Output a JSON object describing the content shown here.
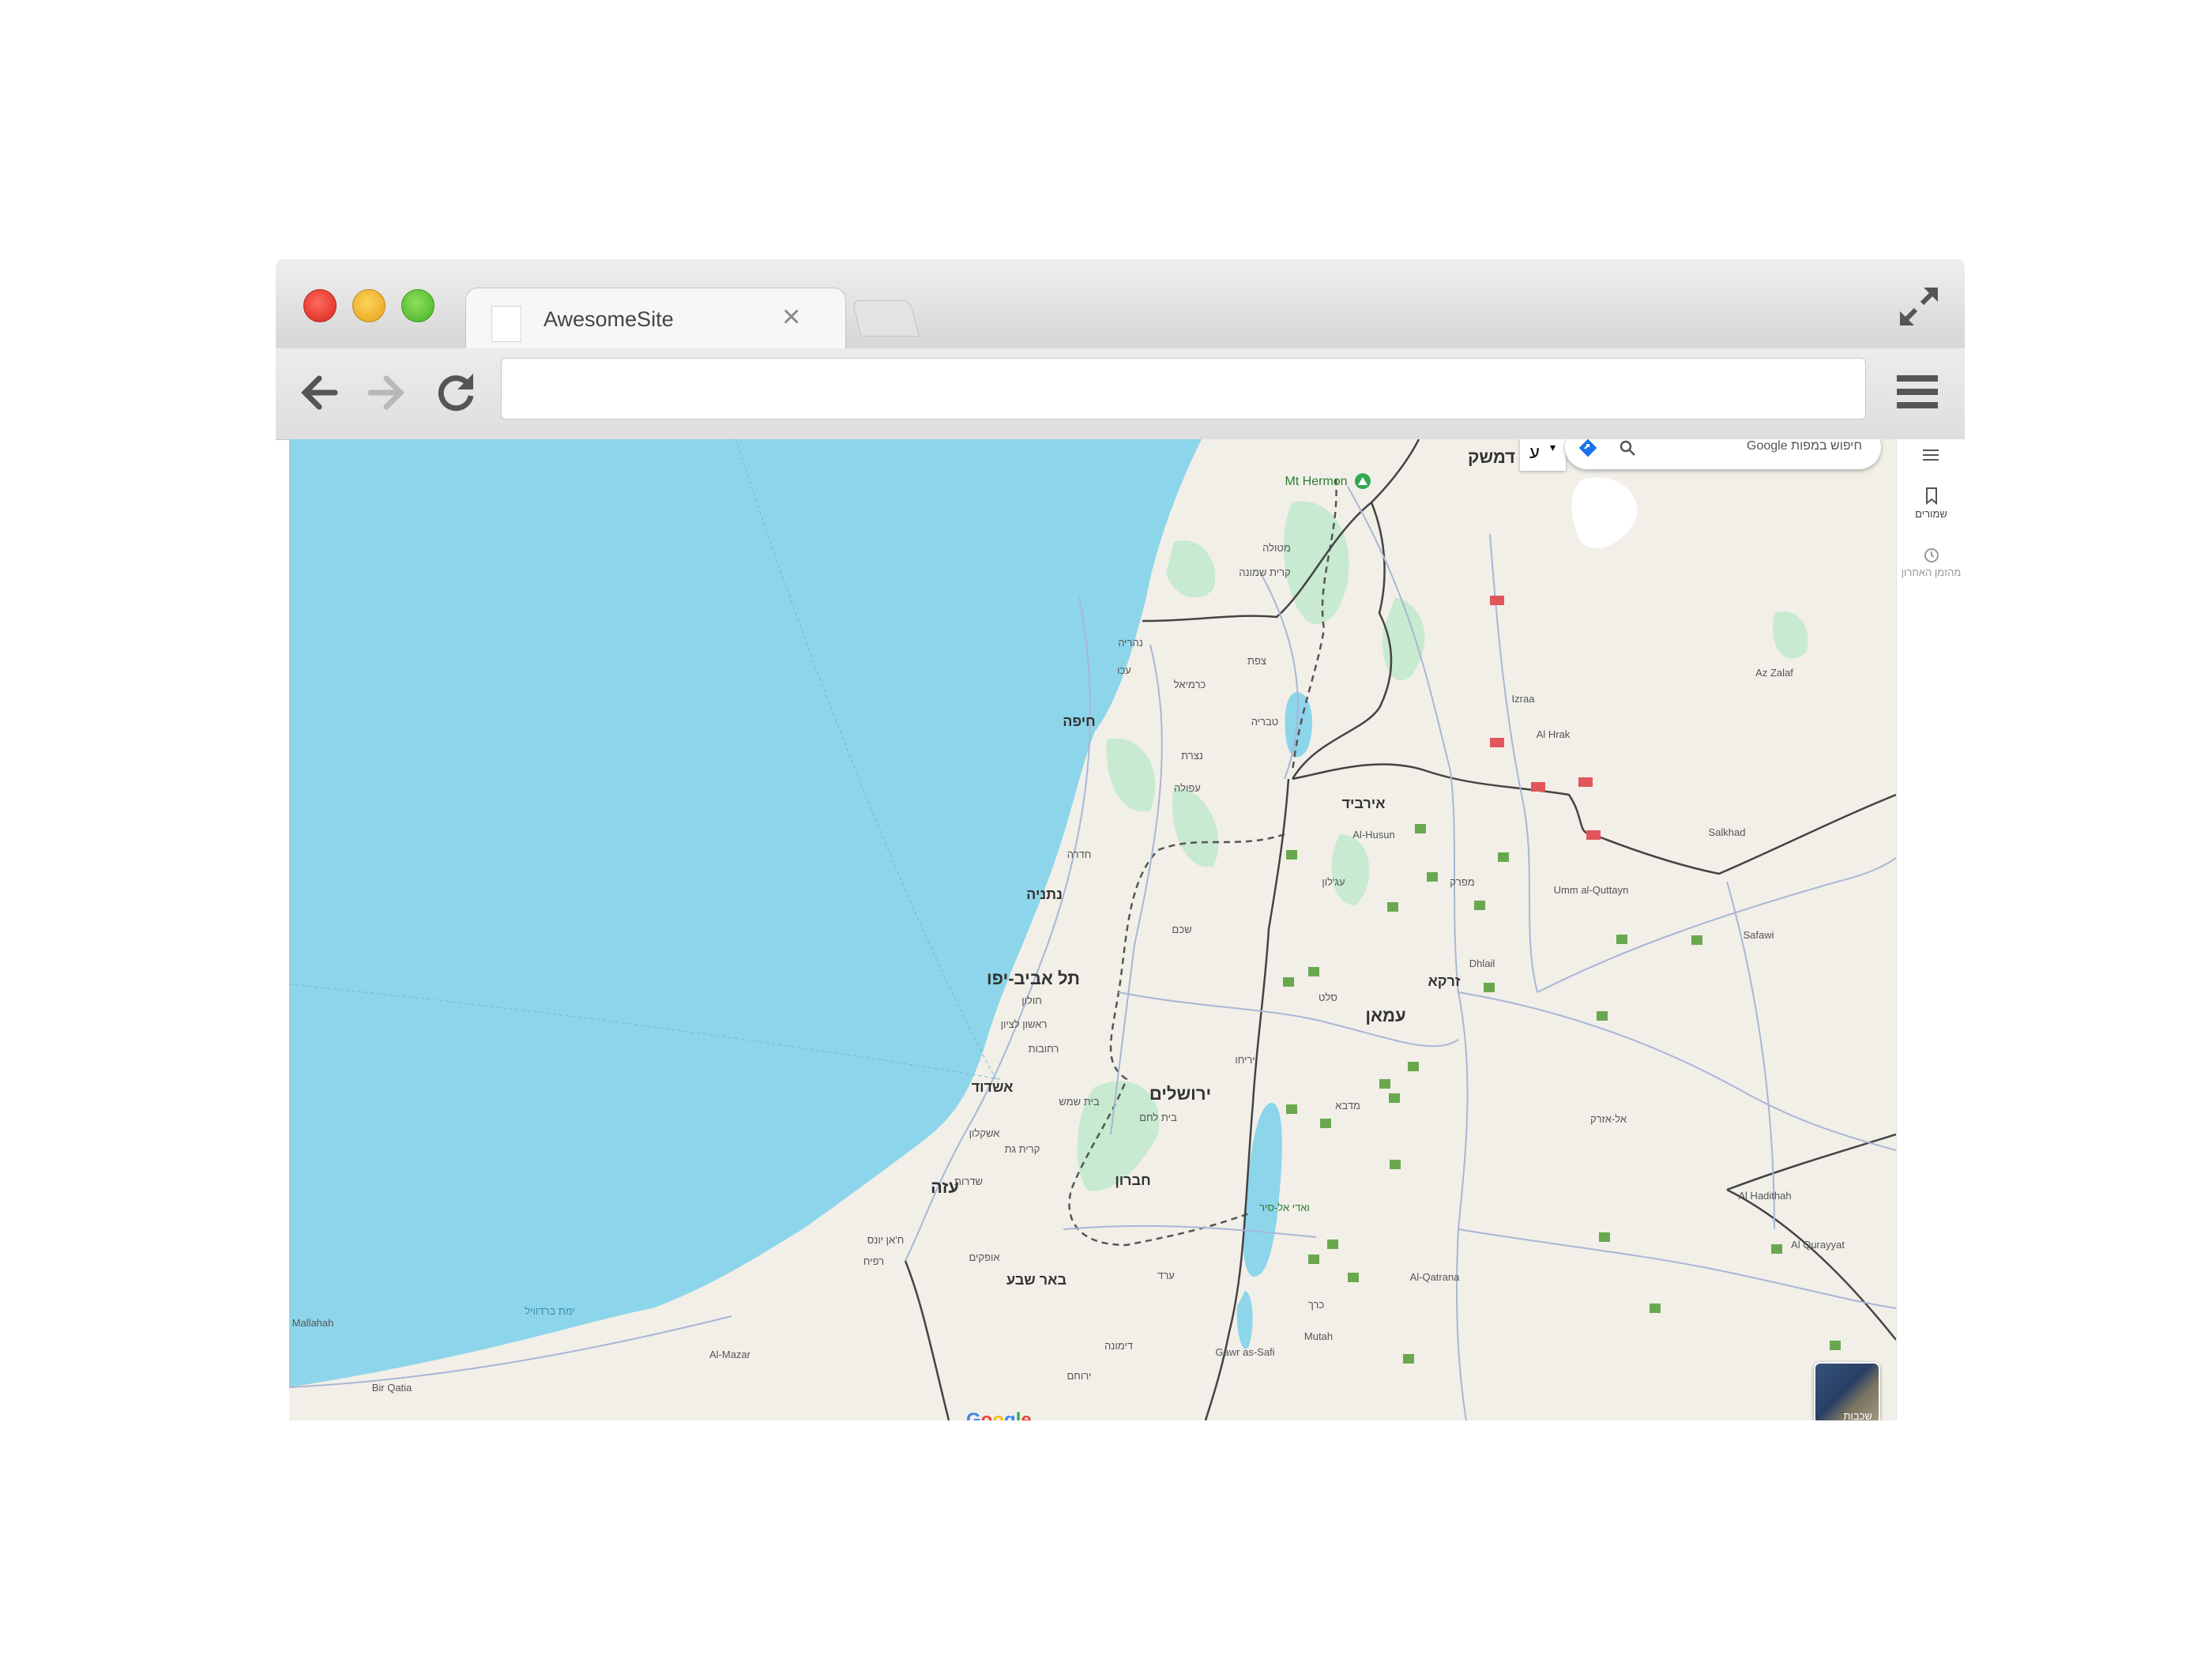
{
  "browser": {
    "tab_title": "AwesomeSite",
    "tab_close": "×",
    "url": ""
  },
  "map": {
    "search_placeholder": "חיפוש במפות Google",
    "lang_label": "ע",
    "sidebar": {
      "saved": "שמורים",
      "recent": "מהזמן האחרון"
    },
    "layers_label": "שכבות",
    "google": "Google",
    "colors": {
      "sea": "#8dd5ea",
      "land": "#f1efe8",
      "park": "#c7ead0",
      "road": "#a9b6d6",
      "border": "#444444",
      "green_badge": "#6aa84f"
    },
    "labels_large": {
      "damascus": "דמשק",
      "tel_aviv": "תל אביב-יפו",
      "jerusalem": "ירושלים",
      "amman": "עמאן",
      "gaza": "עזה",
      "haifa": "חיפה",
      "netanya": "נתניה",
      "ashdod": "אשדוד",
      "beer_sheva": "באר שבע",
      "hebron": "חברון",
      "irbid": "אירביד",
      "zarqa": "זרקא",
      "mt_hermon": "Mt Hermon"
    },
    "labels_small": {
      "nazareth": "נצרת",
      "tiberias": "טבריה",
      "afula": "עפולה",
      "hadera": "חדרה",
      "holon": "חולון",
      "rishon": "ראשון לציון",
      "ashkelon": "אשקלון",
      "rehovot": "רחובות",
      "nablus": "שכם",
      "jericho": "יריחו",
      "karmiel": "כרמיאל",
      "safed": "צפת",
      "nahariya": "נהריה",
      "akko": "עכו",
      "kiryat_shmona": "קרית שמונה",
      "metula": "מטולה",
      "azraq": "אל-אזרק",
      "az_zalaf": "Az Zalaf",
      "salkhad": "Salkhad",
      "al_hrak": "Al Hrak",
      "izraa": "Izraa",
      "safawi": "Safawi",
      "dhlail": "Dhlail",
      "al_qatrana": "Al-Qatrana",
      "al_hadithah": "Al Hadithah",
      "al_qurayyat": "Al Qurayyat",
      "al_husun": "Al-Husun",
      "umm_al_quttayn": "Umm al-Quttayn",
      "mutah": "Mutah",
      "gawr_as_safi": "Gawr as-Safi",
      "al_mazar": "Al-Mazar",
      "bir_qatia": "Bir Qatia",
      "mallahah": "Mallahah",
      "rafah": "רפיח",
      "khan_yunis": "ח'אן יונס",
      "dimona": "דימונה",
      "yeruham": "ירוחם",
      "arad": "ערד",
      "ofakim": "אופקים",
      "sderot": "שדרות",
      "kiryat_gat": "קרית גת",
      "beit_shemesh": "בית שמש",
      "bethlehem": "בית לחם",
      "madaba": "מדבא",
      "karak": "כרך",
      "salt": "סלט",
      "ajloun": "עג'לון",
      "mafraq": "מפרק",
      "wadi_sir": "ואדי אל-סיר",
      "bardawil": "ימת ברדוויל"
    }
  }
}
